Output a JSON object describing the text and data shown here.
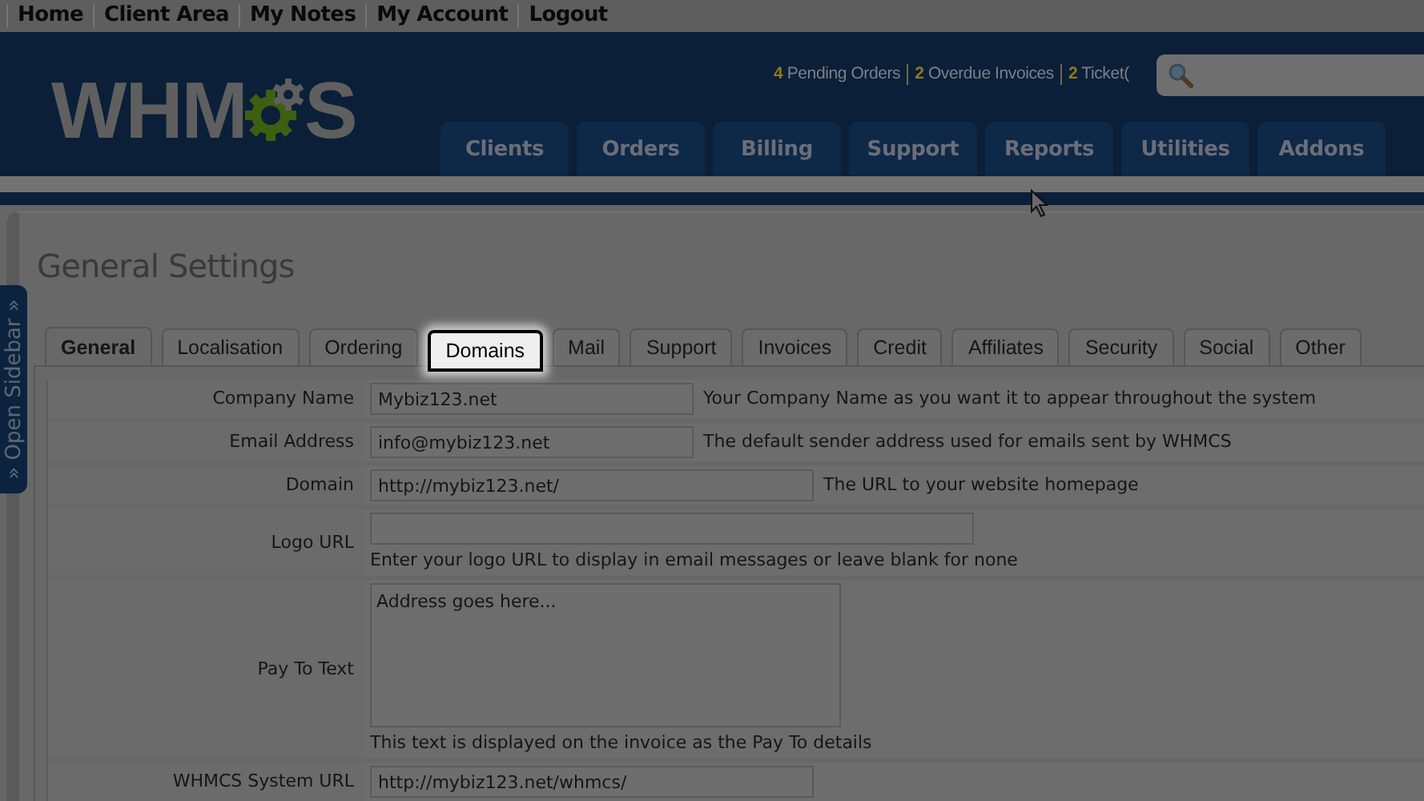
{
  "top_links": [
    "Home",
    "Client Area",
    "My Notes",
    "My Account",
    "Logout"
  ],
  "logo": {
    "before_gear": "WHM",
    "after_gear": "S"
  },
  "alerts": [
    {
      "count": "4",
      "label": "Pending Orders"
    },
    {
      "count": "2",
      "label": "Overdue Invoices"
    },
    {
      "count": "2",
      "label": "Ticket("
    }
  ],
  "nav": [
    "Clients",
    "Orders",
    "Billing",
    "Support",
    "Reports",
    "Utilities",
    "Addons"
  ],
  "open_sidebar": "» Open Sidebar »",
  "page_title": "General Settings",
  "config_tabs": [
    {
      "label": "General",
      "selected": true,
      "highlighted": false
    },
    {
      "label": "Localisation",
      "selected": false,
      "highlighted": false
    },
    {
      "label": "Ordering",
      "selected": false,
      "highlighted": false
    },
    {
      "label": "Domains",
      "selected": false,
      "highlighted": true
    },
    {
      "label": "Mail",
      "selected": false,
      "highlighted": false
    },
    {
      "label": "Support",
      "selected": false,
      "highlighted": false
    },
    {
      "label": "Invoices",
      "selected": false,
      "highlighted": false
    },
    {
      "label": "Credit",
      "selected": false,
      "highlighted": false
    },
    {
      "label": "Affiliates",
      "selected": false,
      "highlighted": false
    },
    {
      "label": "Security",
      "selected": false,
      "highlighted": false
    },
    {
      "label": "Social",
      "selected": false,
      "highlighted": false
    },
    {
      "label": "Other",
      "selected": false,
      "highlighted": false
    }
  ],
  "settings": [
    {
      "label": "Company Name",
      "kind": "input",
      "value": "Mybiz123.net",
      "hint": "Your Company Name as you want it to appear throughout the system",
      "hint_below": false
    },
    {
      "label": "Email Address",
      "kind": "input",
      "value": "info@mybiz123.net",
      "hint": "The default sender address used for emails sent by WHMCS",
      "hint_below": false
    },
    {
      "label": "Domain",
      "kind": "input",
      "value": "http://mybiz123.net/",
      "hint": "The URL to your website homepage",
      "hint_below": false
    },
    {
      "label": "Logo URL",
      "kind": "input",
      "hint": "Enter your logo URL to display in email messages or leave blank for none",
      "hint_below": true
    },
    {
      "label": "Pay To Text",
      "kind": "textarea",
      "value": "Address goes here...",
      "hint": "This text is displayed on the invoice as the Pay To details",
      "hint_below": true
    },
    {
      "label": "WHMCS System URL",
      "kind": "input",
      "value": "http://mybiz123.net/whmcs/",
      "hint_below": false
    }
  ]
}
